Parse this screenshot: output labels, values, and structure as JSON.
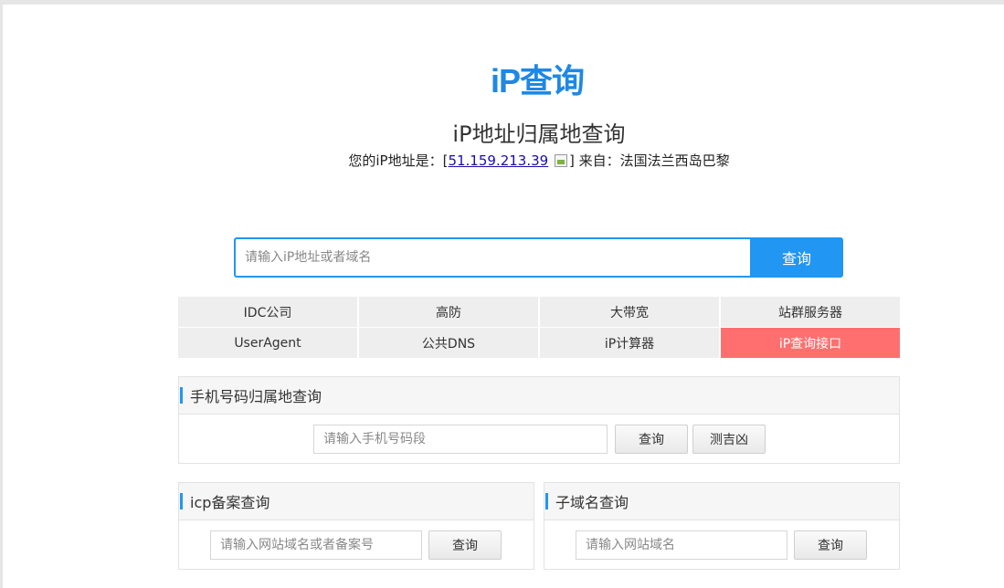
{
  "logo": {
    "text": "iP查询"
  },
  "header": {
    "title": "iP地址归属地查询",
    "ip_prefix": "您的iP地址是：[",
    "ip_address": "51.159.213.39",
    "ip_suffix": "] 来自：法国法兰西岛巴黎"
  },
  "search": {
    "placeholder": "请输入iP地址或者域名",
    "button_label": "查询"
  },
  "quick_links": [
    {
      "label": "IDC公司"
    },
    {
      "label": "高防"
    },
    {
      "label": "大带宽"
    },
    {
      "label": "站群服务器"
    },
    {
      "label": "UserAgent"
    },
    {
      "label": "公共DNS"
    },
    {
      "label": "iP计算器"
    },
    {
      "label": "iP查询接口"
    }
  ],
  "phone_panel": {
    "title": "手机号码归属地查询",
    "placeholder": "请输入手机号码段",
    "query_label": "查询",
    "fortune_label": "测吉凶"
  },
  "icp_panel": {
    "title": "icp备案查询",
    "placeholder": "请输入网站域名或者备案号",
    "query_label": "查询"
  },
  "subdomain_panel": {
    "title": "子域名查询",
    "placeholder": "请输入网站域名",
    "query_label": "查询"
  },
  "colors": {
    "accent": "#2196f3",
    "hot": "#ff6f6f"
  }
}
